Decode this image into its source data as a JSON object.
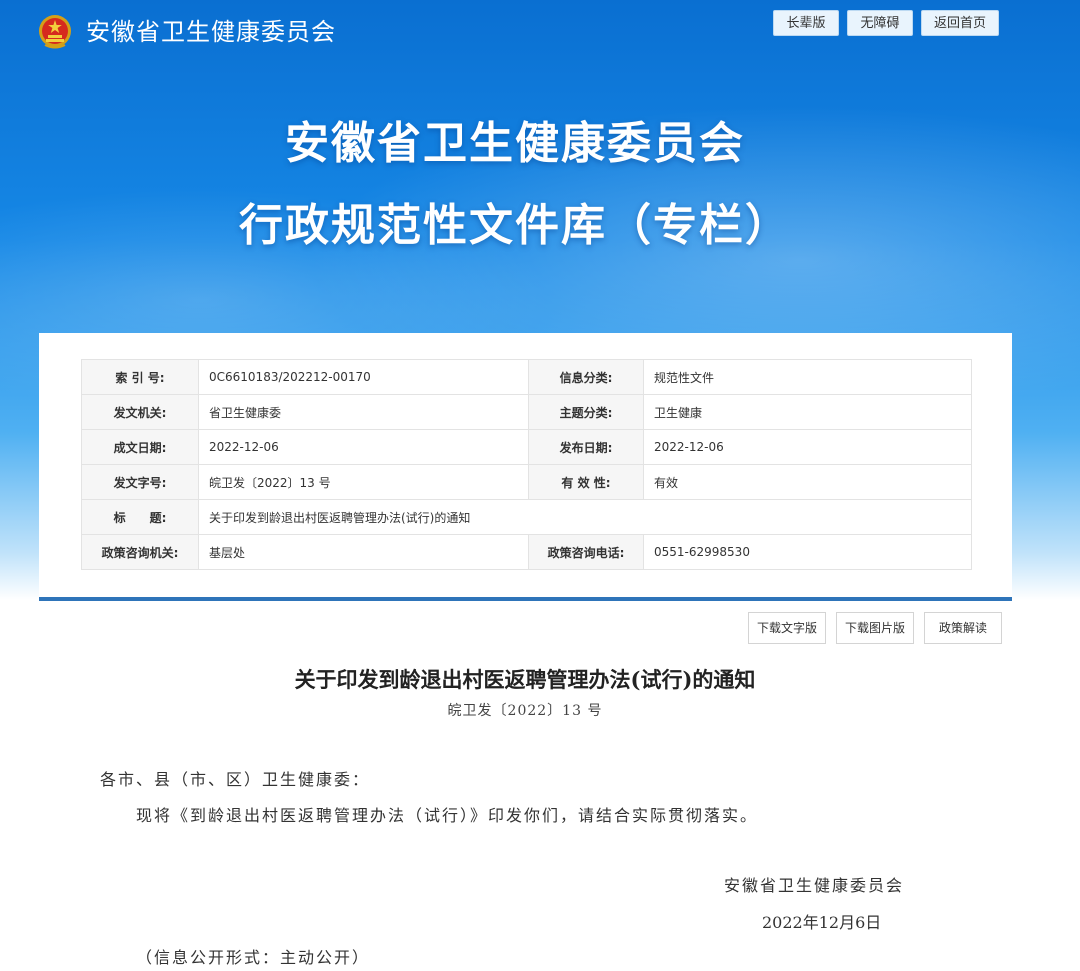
{
  "header": {
    "site_name": "安徽省卫生健康委员会",
    "buttons": [
      "长辈版",
      "无障碍",
      "返回首页"
    ]
  },
  "hero": {
    "line1": "安徽省卫生健康委员会",
    "line2": "行政规范性文件库（专栏）"
  },
  "meta": {
    "index_label": "索 引 号:",
    "index_value": "0C6610183/202212-00170",
    "category_label": "信息分类:",
    "category_value": "规范性文件",
    "issuer_label": "发文机关:",
    "issuer_value": "省卫生健康委",
    "topic_label": "主题分类:",
    "topic_value": "卫生健康",
    "created_label": "成文日期:",
    "created_value": "2022-12-06",
    "published_label": "发布日期:",
    "published_value": "2022-12-06",
    "docno_label": "发文字号:",
    "docno_value": "皖卫发〔2022〕13 号",
    "validity_label": "有 效 性:",
    "validity_value": "有效",
    "title_label": "标　　题:",
    "title_value": "关于印发到龄退出村医返聘管理办法(试行)的通知",
    "consult_org_label": "政策咨询机关:",
    "consult_org_value": "基层处",
    "consult_phone_label": "政策咨询电话:",
    "consult_phone_value": "0551-62998530"
  },
  "doc_actions": {
    "download_text": "下载文字版",
    "download_image": "下载图片版",
    "policy_interpretation": "政策解读"
  },
  "document": {
    "title": "关于印发到龄退出村医返聘管理办法(试行)的通知",
    "number": "皖卫发〔2022〕13 号",
    "salutation": "各市、县（市、区）卫生健康委：",
    "body": "现将《到龄退出村医返聘管理办法（试行）》印发你们，请结合实际贯彻落实。",
    "signature": "安徽省卫生健康委员会",
    "date": "2022年12月6日",
    "disclosure": "（信息公开形式：主动公开）"
  },
  "colors": {
    "banner_blue": "#1688e6",
    "divider_blue": "#2e74b9"
  }
}
